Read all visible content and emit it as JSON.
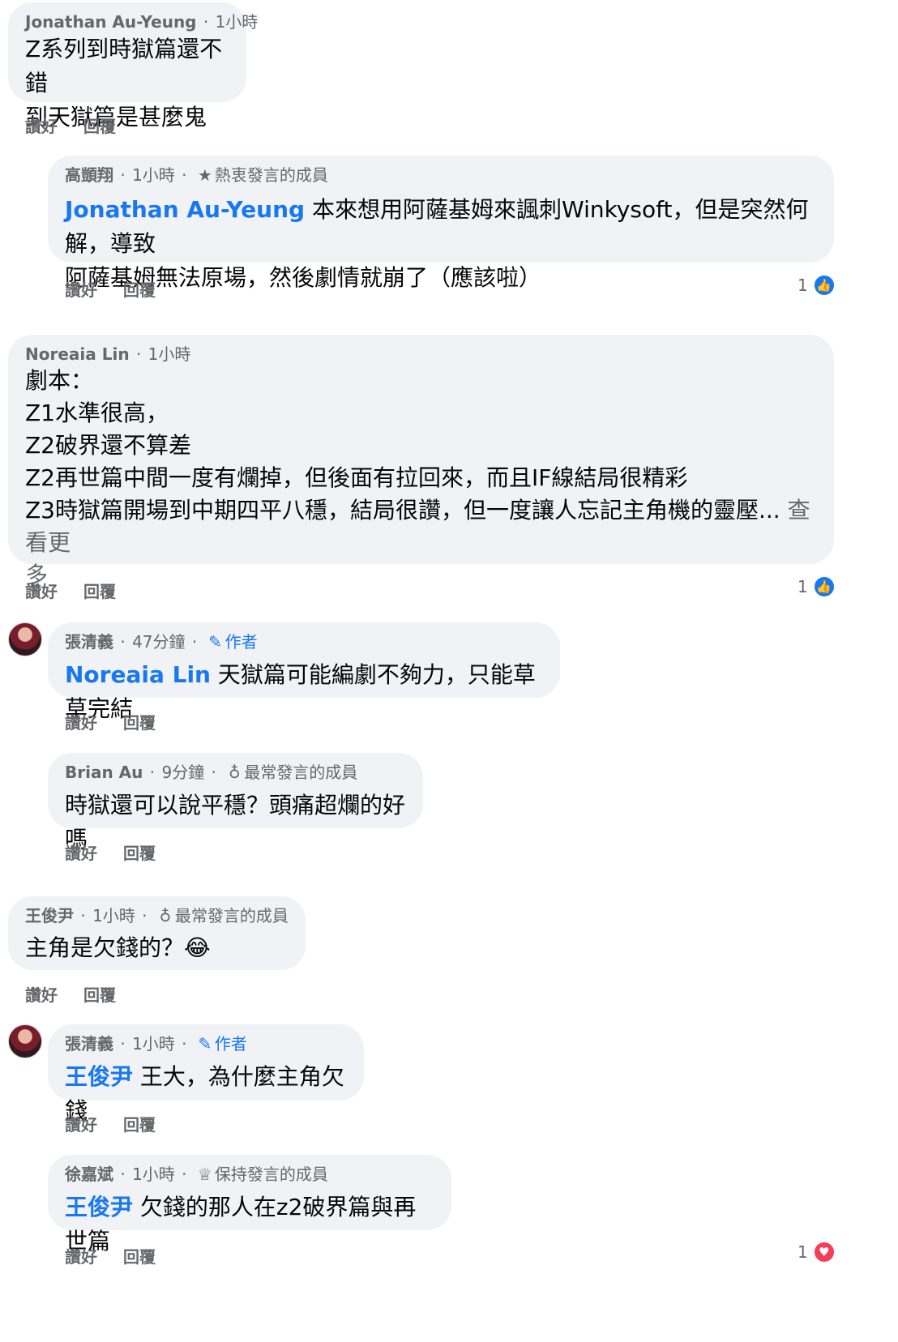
{
  "comments": [
    {
      "name": "Jonathan Au-Yeung",
      "time": "1小時",
      "lines": [
        "Z系列到時獄篇還不錯",
        "到天獄篇是甚麼鬼"
      ],
      "like_label": "讚好",
      "reply_label": "回覆"
    },
    {
      "name": "高顗翔",
      "time": "1小時",
      "badge_icon": "star-icon",
      "badge": "熱衷發言的成員",
      "mention": "Jonathan Au-Yeung",
      "line1": " 本來想用阿薩基姆來諷刺Winkysoft，但是突然何解，導致",
      "line2": "阿薩基姆無法原場，然後劇情就崩了（應該啦）",
      "like_label": "讚好",
      "reply_label": "回覆",
      "reaction_count": "1",
      "reaction_icon": "like-icon"
    },
    {
      "name": "Noreaia Lin",
      "time": "1小時",
      "lines": [
        "劇本：",
        "Z1水準很高，",
        "Z2破界還不算差",
        "Z2再世篇中間一度有爛掉，但後面有拉回來，而且IF線結局很精彩",
        "Z3時獄篇開場到中期四平八穩，結局很讚，但一度讓人忘記主角機的靈壓..."
      ],
      "see_more": "查看更",
      "see_more_tail": "多",
      "like_label": "讚好",
      "reply_label": "回覆",
      "reaction_count": "1",
      "reaction_icon": "like-icon"
    },
    {
      "name": "張清義",
      "time": "47分鐘",
      "badge_icon": "pencil-icon",
      "badge": "作者",
      "mention": "Noreaia Lin",
      "text": " 天獄篇可能編劇不夠力，只能草草完結",
      "like_label": "讚好",
      "reply_label": "回覆"
    },
    {
      "name": "Brian Au",
      "time": "9分鐘",
      "badge_icon": "award-icon",
      "badge": "最常發言的成員",
      "text": "時獄還可以說平穩？頭痛超爛的好嗎",
      "like_label": "讚好",
      "reply_label": "回覆"
    },
    {
      "name": "王俊尹",
      "time": "1小時",
      "badge_icon": "award-icon",
      "badge": "最常發言的成員",
      "text": "主角是欠錢的？",
      "emoji": "😂",
      "like_label": "讚好",
      "reply_label": "回覆"
    },
    {
      "name": "張清義",
      "time": "1小時",
      "badge_icon": "pencil-icon",
      "badge": "作者",
      "mention": "王俊尹",
      "text": " 王大，為什麼主角欠錢",
      "like_label": "讚好",
      "reply_label": "回覆"
    },
    {
      "name": "徐嘉斌",
      "time": "1小時",
      "badge_icon": "trophy-icon",
      "badge": "保持發言的成員",
      "mention": "王俊尹",
      "text": " 欠錢的那人在z2破界篇與再世篇",
      "like_label": "讚好",
      "reply_label": "回覆",
      "reaction_count": "1",
      "reaction_icon": "love-icon"
    }
  ],
  "colors": {
    "bubble": "#f0f2f5",
    "mention": "#1877f2",
    "meta": "#65676b",
    "like": "#1877f2",
    "love": "#f33e58"
  }
}
